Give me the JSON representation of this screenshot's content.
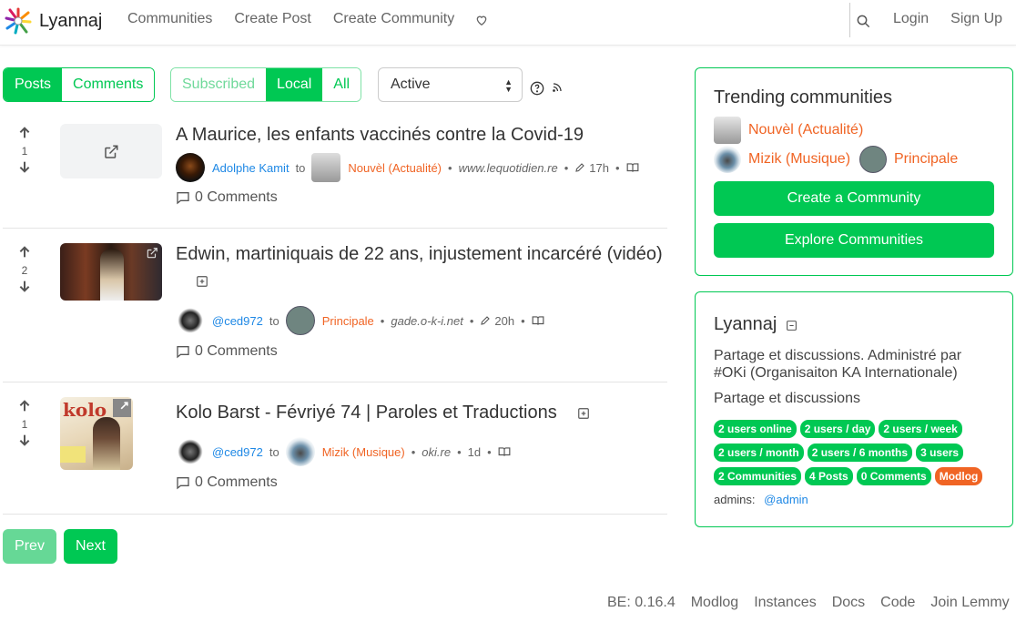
{
  "nav": {
    "brand": "Lyannaj",
    "links": [
      "Communities",
      "Create Post",
      "Create Community"
    ],
    "login": "Login",
    "signup": "Sign Up"
  },
  "controls": {
    "view_tabs": [
      "Posts",
      "Comments"
    ],
    "listing_tabs": [
      "Subscribed",
      "Local",
      "All"
    ],
    "sort_value": "Active"
  },
  "posts": [
    {
      "votes": "1",
      "title": "A Maurice, les enfants vaccinés contre la Covid-19",
      "author": "Adolphe Kamit",
      "to": "to",
      "community": "Nouvèl (Actualité)",
      "site": "www.lequotidien.re",
      "age": "17h",
      "comments": "0 Comments"
    },
    {
      "votes": "2",
      "title": "Edwin, martiniquais de 22 ans, injustement incarcéré (vidéo)",
      "author": "@ced972",
      "to": "to",
      "community": "Principale",
      "site": "gade.o-k-i.net",
      "age": "20h",
      "comments": "0 Comments"
    },
    {
      "votes": "1",
      "title": "Kolo Barst - Févriyé 74 | Paroles et Traductions",
      "author": "@ced972",
      "to": "to",
      "community": "Mizik (Musique)",
      "site": "oki.re",
      "age": "1d",
      "comments": "0 Comments",
      "thumb_text": "kolo"
    }
  ],
  "pagination": {
    "prev": "Prev",
    "next": "Next"
  },
  "trending": {
    "title": "Trending communities",
    "communities": [
      "Nouvèl (Actualité)",
      "Mizik (Musique)",
      "Principale"
    ],
    "create_button": "Create a Community",
    "explore_button": "Explore Communities"
  },
  "site": {
    "name": "Lyannaj",
    "description": "Partage et discussions. Administré par #OKi (Organisaiton KA Internationale)",
    "tagline": "Partage et discussions",
    "badges": [
      "2 users online",
      "2 users / day",
      "2 users / week",
      "2 users / month",
      "2 users / 6 months",
      "3 users",
      "2 Communities",
      "4 Posts",
      "0 Comments",
      "Modlog"
    ],
    "admins_label": "admins:",
    "admin": "@admin"
  },
  "footer": [
    "BE: 0.16.4",
    "Modlog",
    "Instances",
    "Docs",
    "Code",
    "Join Lemmy"
  ],
  "colors": {
    "accent": "#00c853",
    "community": "#f06424",
    "user": "#1e88e5"
  }
}
